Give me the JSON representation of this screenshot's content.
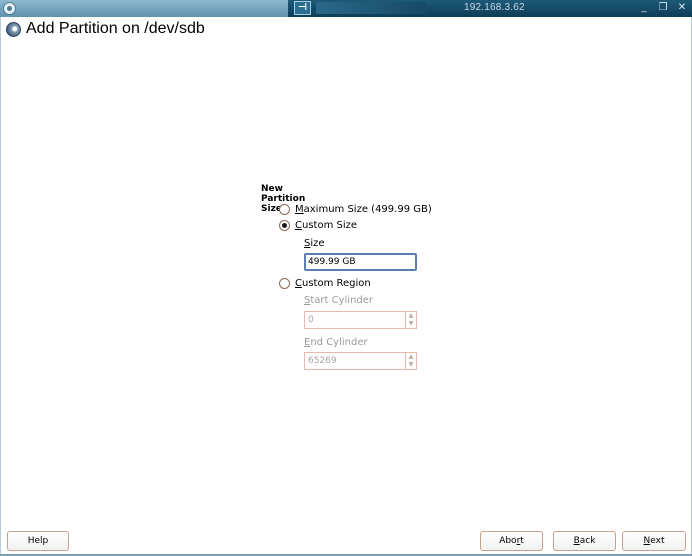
{
  "titlebar": {
    "host": "192.168.3.62",
    "conn_icon": "connection-icon",
    "minimize": "_",
    "restore": "❐",
    "close": "✕"
  },
  "dialog": {
    "title": "Add Partition on /dev/sdb",
    "icon": "disk-icon"
  },
  "group": {
    "title": "New Partition Size",
    "options": [
      {
        "label_prefix": "",
        "label_accel": "M",
        "label_rest": "aximum Size (499.99 GB)",
        "checked": false
      },
      {
        "label_prefix": "",
        "label_accel": "C",
        "label_rest": "ustom Size",
        "checked": true
      },
      {
        "label_prefix": "",
        "label_accel": "C",
        "label_rest": "ustom Region",
        "checked": false
      }
    ],
    "size": {
      "label_accel": "S",
      "label_rest": "ize",
      "value": "499.99 GB"
    },
    "start_cylinder": {
      "label_accel": "S",
      "label_rest": "tart Cylinder",
      "value": "0"
    },
    "end_cylinder": {
      "label_accel": "E",
      "label_rest": "nd Cylinder",
      "value": "65269"
    }
  },
  "buttons": {
    "help": "Help",
    "abort_prefix": "Abo",
    "abort_accel": "r",
    "abort_rest": "t",
    "back_accel": "B",
    "back_rest": "ack",
    "next_accel": "N",
    "next_rest": "ext"
  },
  "colors": {
    "titlebar": "#0e3d57",
    "accent_border": "#c9a08a",
    "focus_border": "#5b7fae"
  }
}
